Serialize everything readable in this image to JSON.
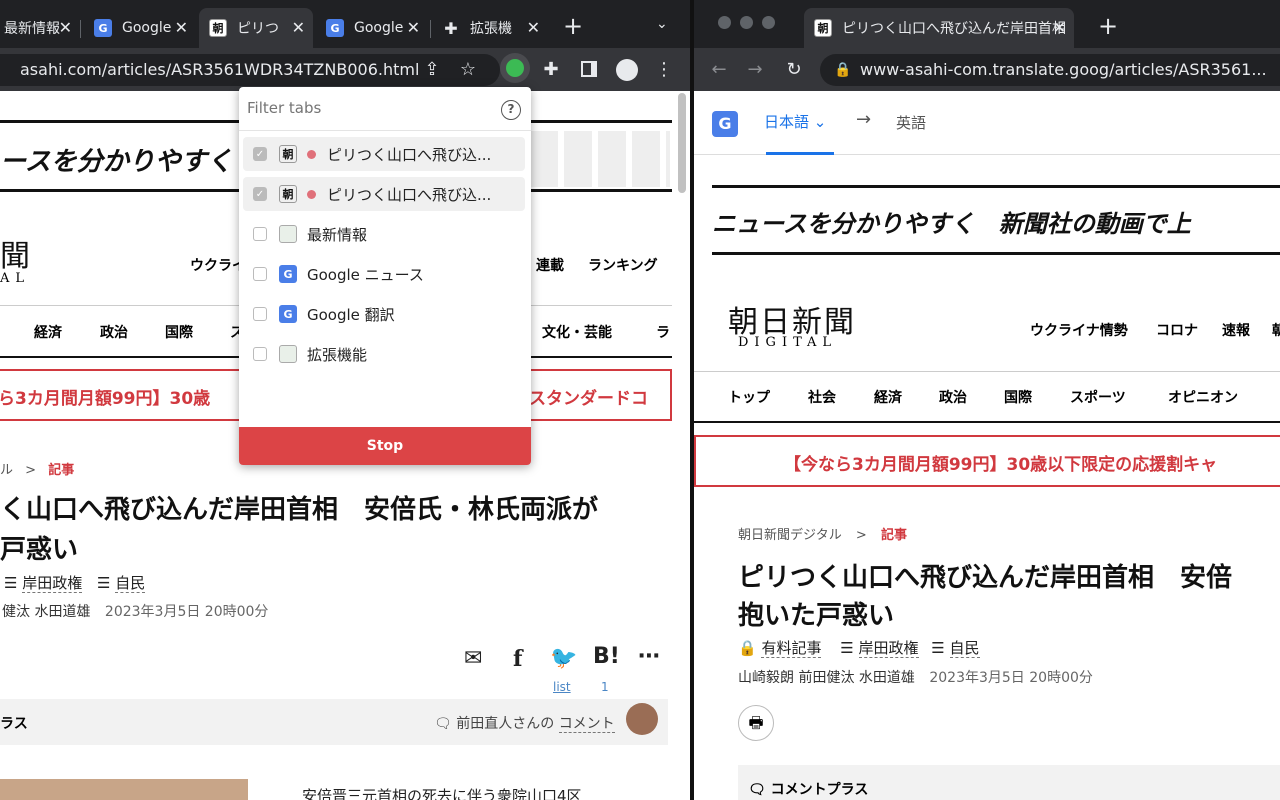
{
  "left_window": {
    "tabs": [
      {
        "title": "最新情報",
        "icon": "image-favicon-icon"
      },
      {
        "title": "Google",
        "icon": "google-news-icon"
      },
      {
        "title": "ピリつ",
        "icon": "asahi-favicon-icon"
      },
      {
        "title": "Google",
        "icon": "google-translate-icon"
      },
      {
        "title": "拡張機",
        "icon": "puzzle-icon"
      }
    ],
    "new_tab": "+",
    "url": "asahi.com/articles/ASR3561WDR34TZNB006.html",
    "page": {
      "banner_text": "ースを分かりやすく",
      "logo_partial": "聞",
      "logo_sub": "AL",
      "nav_top": [
        "ウクライ",
        "連載",
        "ランキング"
      ],
      "nav_cats": [
        "経済",
        "政治",
        "国際",
        "ス",
        "文化・芸能",
        "ラ"
      ],
      "promo": "ら3カ月間月額99円】30歳",
      "promo_right": "！スタンダードコ",
      "breadcrumb_prev": "ル",
      "breadcrumb_sep": ">",
      "breadcrumb_current": "記事",
      "headline_line1": "く山口へ飛び込んだ岸田首相　安倍氏・林氏両派が",
      "headline_line2": "戸惑い",
      "tags": [
        "岸田政権",
        "自民"
      ],
      "byline": "健汰 水田道雄",
      "date": "2023年3月5日 20時00分",
      "share_list": "list",
      "share_count": "1",
      "comment_section": "ラス",
      "commenter": "前田直人さんの",
      "comment_link": "コメント",
      "related": "安倍晋三元首相の死去に伴う衆院山口4区"
    },
    "popup": {
      "filter_placeholder": "Filter tabs",
      "help": "?",
      "rows": [
        {
          "label": "ピリつく山口へ飛び込...",
          "checked": true,
          "dot": true
        },
        {
          "label": "ピリつく山口へ飛び込...",
          "checked": true,
          "dot": true
        },
        {
          "label": "最新情報",
          "checked": false,
          "dot": false
        },
        {
          "label": "Google ニュース",
          "checked": false,
          "dot": false
        },
        {
          "label": "Google 翻訳",
          "checked": false,
          "dot": false
        },
        {
          "label": "拡張機能",
          "checked": false,
          "dot": false
        }
      ],
      "stop_label": "Stop"
    }
  },
  "right_window": {
    "tab_title": "ピリつく山口へ飛び込んだ岸田首相",
    "new_tab": "+",
    "url": "www-asahi-com.translate.goog/articles/ASR3561...",
    "translate_bar": {
      "source": "日本語",
      "arrow": "→",
      "target": "英語"
    },
    "page": {
      "banner_text": "ニュースを分かりやすく　新聞社の動画で上",
      "logo": "朝日新聞",
      "logo_sub": "DIGITAL",
      "nav_top": [
        "ウクライナ情勢",
        "コロナ",
        "速報",
        "朝"
      ],
      "nav_cats": [
        "トップ",
        "社会",
        "経済",
        "政治",
        "国際",
        "スポーツ",
        "オピニオン"
      ],
      "promo": "【今なら3カ月間月額99円】30歳以下限定の応援割キャ",
      "breadcrumb_home": "朝日新聞デジタル",
      "breadcrumb_sep": ">",
      "breadcrumb_current": "記事",
      "headline_line1": "ピリつく山口へ飛び込んだ岸田首相　安倍",
      "headline_line2": "抱いた戸惑い",
      "paid": "有料記事",
      "tags": [
        "岸田政権",
        "自民"
      ],
      "byline": "山崎毅朗 前田健汰 水田道雄",
      "date": "2023年3月5日 20時00分",
      "comment_section": "コメントプラス"
    }
  },
  "colors": {
    "chrome_dark": "#202124",
    "chrome_toolbar": "#35363a",
    "asahi_red": "#d1393f",
    "stop_red": "#dc4446",
    "translate_blue": "#1a73e8"
  }
}
